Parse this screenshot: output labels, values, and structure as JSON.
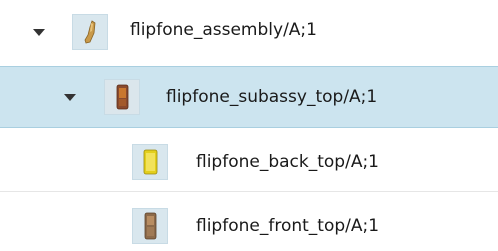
{
  "tree": {
    "items": [
      {
        "label": "flipfone_assembly/A;1",
        "expanded": true,
        "selected": false,
        "icon": "assembly-part-icon"
      },
      {
        "label": "flipfone_subassy_top/A;1",
        "expanded": true,
        "selected": true,
        "icon": "subassembly-part-icon"
      },
      {
        "label": "flipfone_back_top/A;1",
        "expanded": false,
        "selected": false,
        "icon": "yellow-part-icon"
      },
      {
        "label": "flipfone_front_top/A;1",
        "expanded": false,
        "selected": false,
        "icon": "bronze-part-icon"
      }
    ],
    "colors": {
      "selection_bg": "#cce4ef",
      "thumb_bg": "#d9e7ee"
    }
  }
}
